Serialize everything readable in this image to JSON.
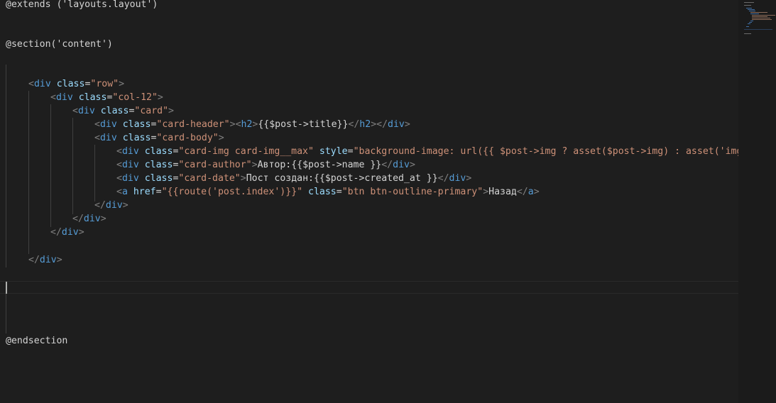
{
  "code_lines": [
    "@extends ('layouts.layout')",
    "@section('content')",
    "<div class=\"row\">",
    "<div class=\"col-12\">",
    "<div class=\"card\">",
    "<div class=\"card-header\"><h2>{{$post->title}}</h2></div>",
    "<div class=\"card-body\">",
    "<div class=\"card-img card-img__max\" style=\"background-image: url({{ $post->img ? asset($post->img) : asset('img/de",
    "<div class=\"card-author\">Автор:{{$post->name }}</div>",
    "<div class=\"card-date\">Пост создан:{{$post->created_at }}</div>",
    "<a href=\"{{route('post.index')}}\" class=\"btn btn-outline-primary\">Назад</a>",
    "</div>",
    "</div>",
    "</div>",
    "</div>",
    "@endsection"
  ],
  "colors": {
    "background": "#1e1e1e",
    "tag": "#569cd6",
    "attribute": "#9cdcfe",
    "string": "#ce9178",
    "punctuation": "#808080",
    "text": "#d4d4d4"
  }
}
